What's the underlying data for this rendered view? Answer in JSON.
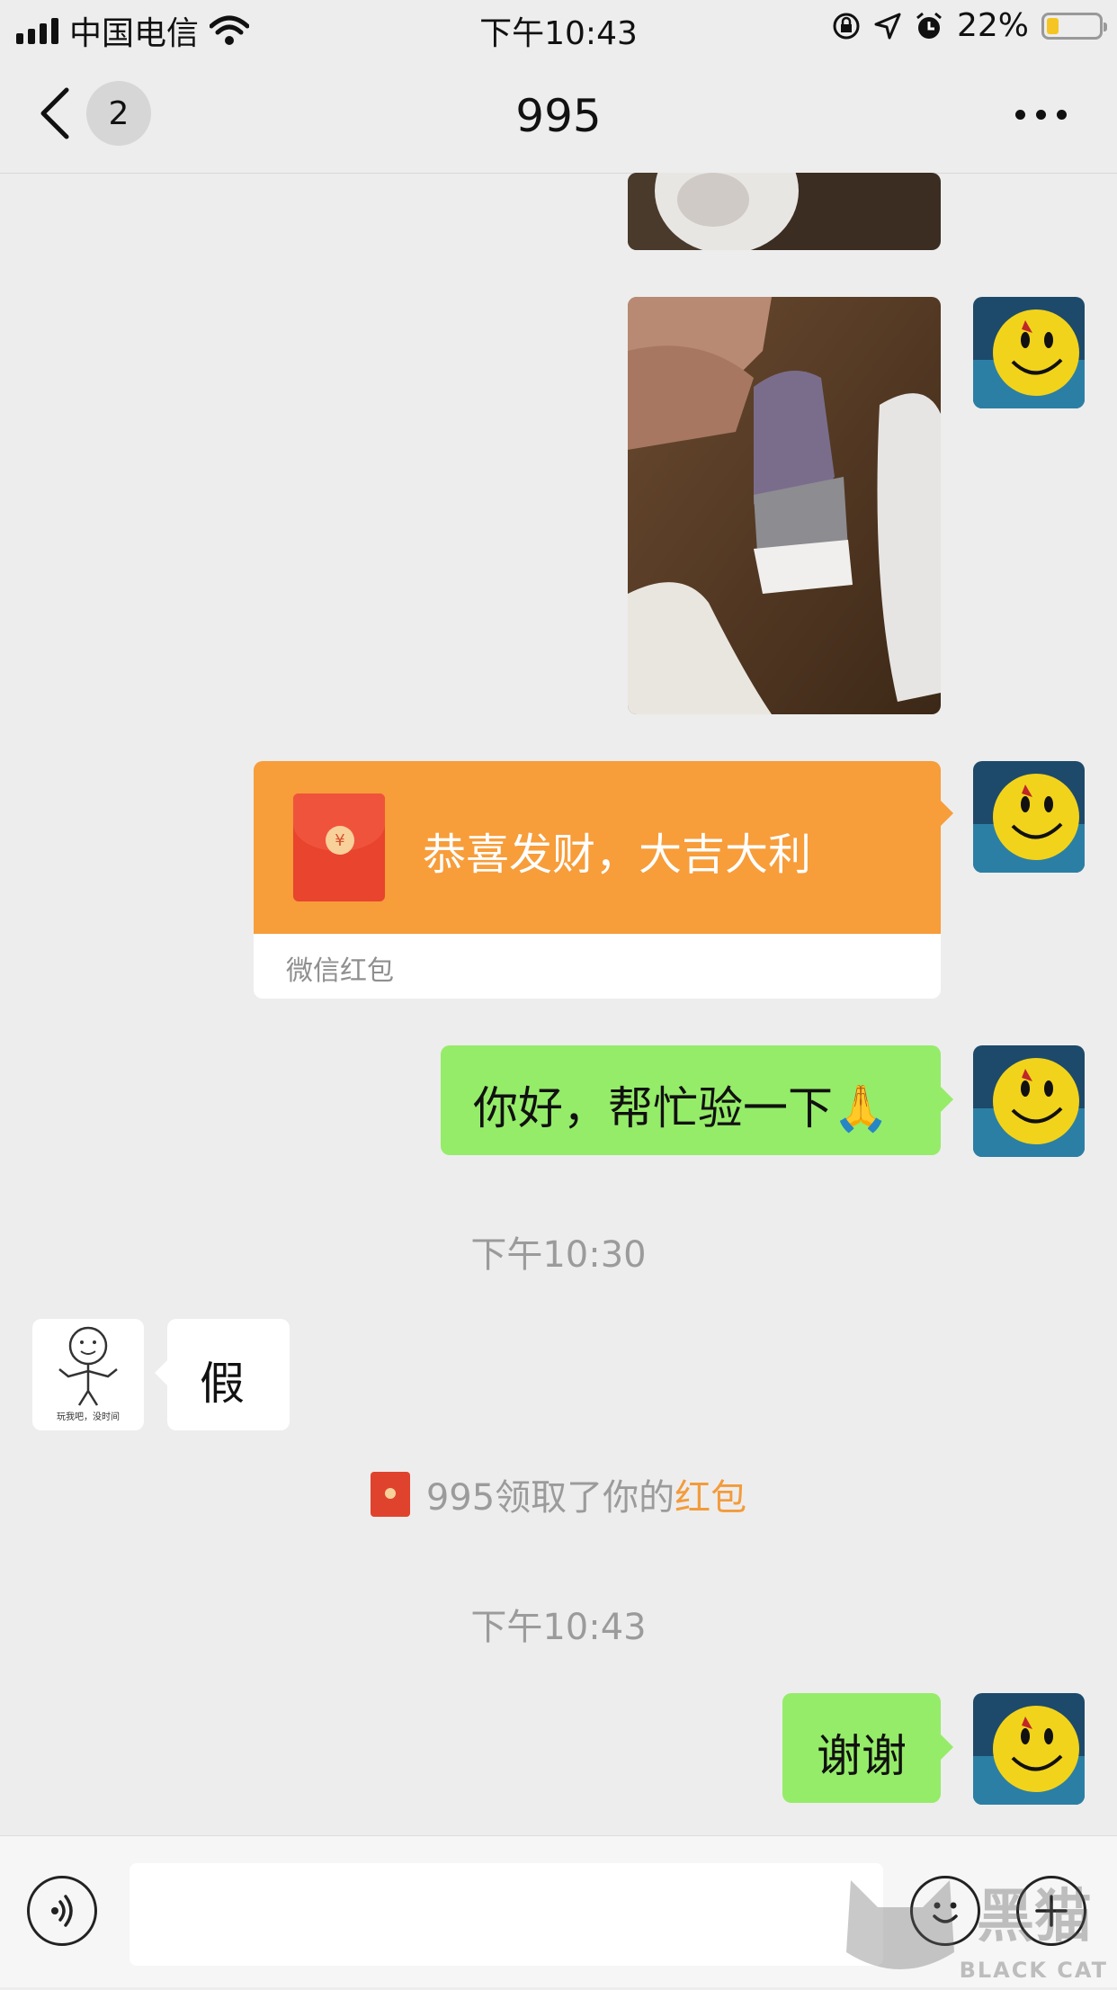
{
  "status_bar": {
    "carrier": "中国电信",
    "time": "下午10:43",
    "battery_percent": "22%",
    "battery_level": 0.22,
    "icons": [
      "signal-icon",
      "wifi-icon",
      "rotation-lock-icon",
      "location-icon",
      "alarm-icon",
      "battery-icon"
    ]
  },
  "nav": {
    "unread_count": "2",
    "title": "995",
    "icons": [
      "back-chevron-icon",
      "more-icon"
    ]
  },
  "messages": {
    "red_packet": {
      "greeting": "恭喜发财，大吉大利",
      "label": "微信红包",
      "icon": "red-packet-icon"
    },
    "request_text": "你好，帮忙验一下🙏",
    "time_1": "下午10:30",
    "reply_text": "假",
    "contact_avatar_caption": "玩我吧，没时间",
    "notice": {
      "prefix": "995领取了你的",
      "link": "红包"
    },
    "time_2": "下午10:43",
    "thanks_text": "谢谢"
  },
  "input_bar": {
    "icons": [
      "voice-icon",
      "emoji-icon",
      "plus-icon"
    ]
  },
  "watermark": {
    "text": "BLACK CAT",
    "cn": "黑猫"
  },
  "colors": {
    "background": "#ededed",
    "my_bubble": "#95ec69",
    "red_packet": "#f79d3a",
    "link": "#f39b3c"
  }
}
